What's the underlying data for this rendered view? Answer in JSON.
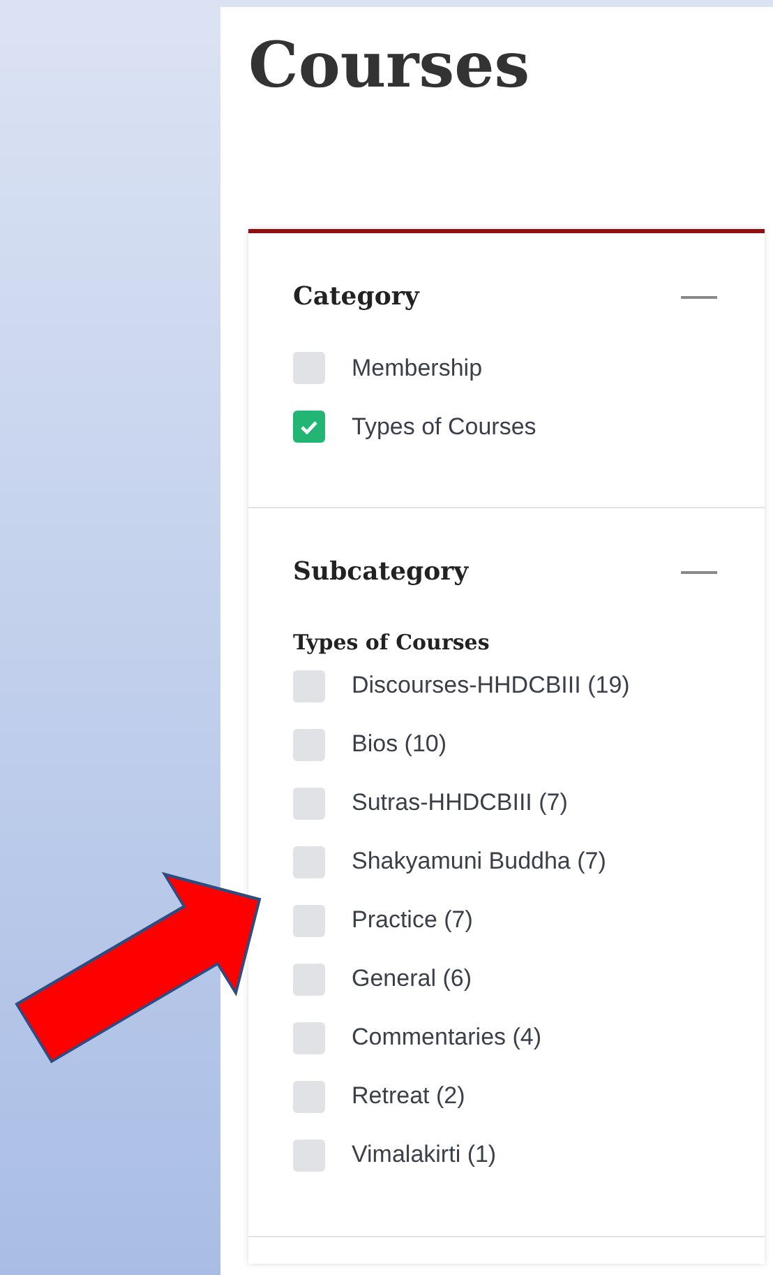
{
  "page_title": "Courses",
  "filters": [
    {
      "title": "Category",
      "expanded": true,
      "groups": [
        {
          "items": [
            {
              "label": "Membership",
              "checked": false
            },
            {
              "label": "Types of Courses",
              "checked": true
            }
          ]
        }
      ]
    },
    {
      "title": "Subcategory",
      "expanded": true,
      "groups": [
        {
          "label": "Types of Courses",
          "items": [
            {
              "label": "Discourses-HHDCBIII (19)",
              "checked": false
            },
            {
              "label": "Bios (10)",
              "checked": false
            },
            {
              "label": "Sutras-HHDCBIII (7)",
              "checked": false
            },
            {
              "label": "Shakyamuni Buddha (7)",
              "checked": false
            },
            {
              "label": "Practice (7)",
              "checked": false
            },
            {
              "label": "General (6)",
              "checked": false
            },
            {
              "label": "Commentaries (4)",
              "checked": false
            },
            {
              "label": "Retreat (2)",
              "checked": false
            },
            {
              "label": "Vimalakirti (1)",
              "checked": false
            }
          ]
        }
      ]
    }
  ]
}
